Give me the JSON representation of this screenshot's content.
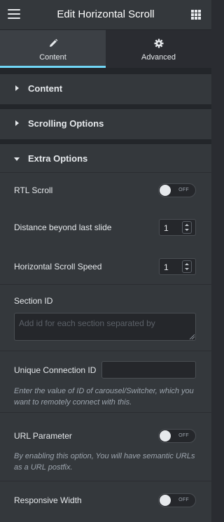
{
  "header": {
    "title": "Edit Horizontal Scroll",
    "menu_icon": "hamburger-icon",
    "grid_icon": "apps-grid-icon"
  },
  "tabs": [
    {
      "label": "Content",
      "icon": "pencil-icon",
      "active": true
    },
    {
      "label": "Advanced",
      "icon": "gear-icon",
      "active": false
    }
  ],
  "sections": [
    {
      "label": "Content",
      "expanded": false
    },
    {
      "label": "Scrolling Options",
      "expanded": false
    },
    {
      "label": "Extra Options",
      "expanded": true
    }
  ],
  "extra_options": {
    "rtl_scroll": {
      "label": "RTL Scroll",
      "toggle": "OFF"
    },
    "distance": {
      "label": "Distance beyond last slide",
      "value": "1"
    },
    "speed": {
      "label": "Horizontal Scroll Speed",
      "value": "1"
    },
    "section_id": {
      "label": "Section ID",
      "placeholder": "Add id for each section separated by"
    },
    "unique_id": {
      "label": "Unique Connection ID",
      "value": "",
      "description": "Enter the value of ID of carousel/Switcher, which you want to remotely connect with this."
    },
    "url_param": {
      "label": "URL Parameter",
      "toggle": "OFF",
      "description": "By enabling this option, You will have semantic URLs as a URL postfix."
    },
    "responsive": {
      "label": "Responsive Width",
      "toggle": "OFF"
    }
  },
  "colors": {
    "accent": "#71d7f7",
    "panel": "#34383c",
    "background": "#2a2c31"
  }
}
